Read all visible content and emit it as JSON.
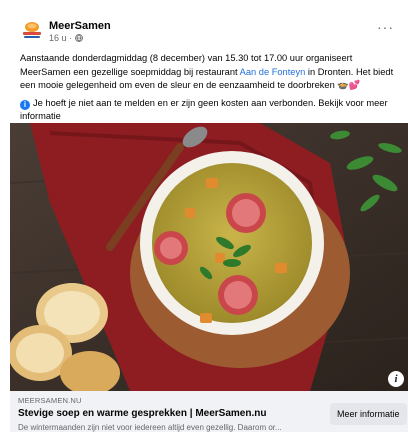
{
  "post": {
    "author": "MeerSamen",
    "time": "16 u",
    "separator": "·",
    "privacy_icon": "globe-icon",
    "more_icon": "more-dots-icon",
    "text_part1": "Aanstaande donderdagmiddag (8 december) van 15.30 tot 17.00 uur organiseert MeerSamen een gezellige soepmiddag bij restaurant ",
    "text_link": "Aan de Fonteyn",
    "text_part2": " in Dronten. Het biedt een mooie gelegenheid om even de sleur en de eenzaamheid te doorbreken 🍲💕",
    "info_text": "Je hoeft je niet aan te melden en er zijn geen kosten aan verbonden. Bekijk voor meer informatie",
    "info_icon": "info-circle-icon"
  },
  "link_preview": {
    "domain": "MEERSAMEN.NU",
    "title": "Stevige soep en warme gesprekken | MeerSamen.nu",
    "description": "De wintermaanden zijn niet voor iedereen altijd even gezellig. Daarom or...",
    "button_label": "Meer informatie",
    "image_info_label": "i"
  },
  "colors": {
    "link": "#216fdb",
    "text": "#050505",
    "secondary": "#65676b",
    "preview_bg": "#f0f2f5"
  }
}
